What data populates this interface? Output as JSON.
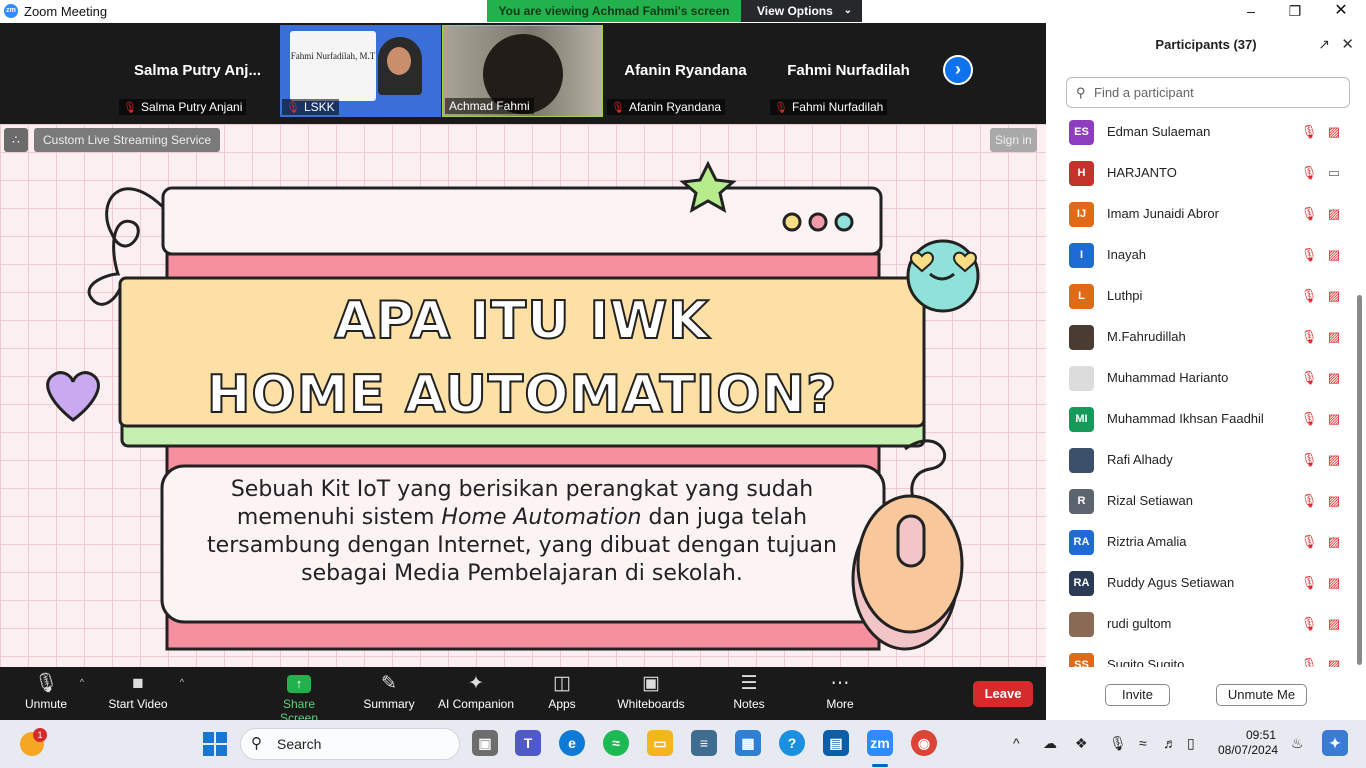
{
  "window": {
    "title": "Zoom Meeting",
    "app_icon": "zm"
  },
  "share_banner": {
    "text": "You are viewing Achmad Fahmi's screen",
    "view_options": "View Options"
  },
  "filmstrip": [
    {
      "big_name": "Salma  Putry  Anj...",
      "label": "Salma Putry Anjani",
      "muted": true
    },
    {
      "card_text": "Fahmi Nurfadilah, M.T",
      "label": "LSKK",
      "muted": true
    },
    {
      "label": "Achmad Fahmi",
      "muted": false
    },
    {
      "big_name": "Afanin Ryandana",
      "label": "Afanin Ryandana",
      "muted": true
    },
    {
      "big_name": "Fahmi Nurfadilah",
      "label": "Fahmi Nurfadilah",
      "muted": true
    }
  ],
  "stage": {
    "stream_label": "Custom Live Streaming Service",
    "sign_in": "Sign in",
    "slide_title_line1": "APA ITU IWK",
    "slide_title_line2": "HOME AUTOMATION?",
    "slide_body_1": "Sebuah  Kit  IoT  yang berisikan  perangkat  yang sudah  memenuhi  sistem ",
    "slide_body_italic": "Home  Automation",
    "slide_body_2": "  dan juga telah  tersambung  dengan  Internet,  yang  dibuat dengan  tujuan  sebagai  Media Pembelajaran di sekolah."
  },
  "toolbar": {
    "unmute": "Unmute",
    "start_video": "Start Video",
    "share_screen": "Share Screen",
    "summary": "Summary",
    "ai_companion": "AI Companion",
    "apps": "Apps",
    "whiteboards": "Whiteboards",
    "notes": "Notes",
    "more": "More",
    "leave": "Leave"
  },
  "participants": {
    "title": "Participants (37)",
    "search_placeholder": "Find a participant",
    "invite": "Invite",
    "unmute_me": "Unmute Me",
    "items": [
      {
        "initials": "ES",
        "name": "Edman Sulaeman",
        "color": "#8e3dbf",
        "video_on": false
      },
      {
        "initials": "H",
        "name": "HARJANTO",
        "color": "#c2332b",
        "video_on": true
      },
      {
        "initials": "IJ",
        "name": "Imam Junaidi Abror",
        "color": "#e06a17",
        "video_on": false
      },
      {
        "initials": "I",
        "name": "Inayah",
        "color": "#1f6bd6",
        "video_on": false
      },
      {
        "initials": "L",
        "name": "Luthpi",
        "color": "#e06a17",
        "video_on": false
      },
      {
        "initials": "",
        "name": "M.Fahrudillah",
        "color": "#4a3b33",
        "video_on": false
      },
      {
        "initials": "",
        "name": "Muhammad Harianto",
        "color": "#dcdcdc",
        "video_on": false
      },
      {
        "initials": "MI",
        "name": "Muhammad Ikhsan Faadhil",
        "color": "#159a5a",
        "video_on": false
      },
      {
        "initials": "",
        "name": "Rafi Alhady",
        "color": "#3c4f6b",
        "video_on": false
      },
      {
        "initials": "R",
        "name": "Rizal Setiawan",
        "color": "#5c6470",
        "video_on": false
      },
      {
        "initials": "RA",
        "name": "Riztria Amalia",
        "color": "#1f6bd6",
        "video_on": false
      },
      {
        "initials": "RA",
        "name": "Ruddy Agus Setiawan",
        "color": "#2c3b55",
        "video_on": false
      },
      {
        "initials": "",
        "name": "rudi gultom",
        "color": "#8a6a55",
        "video_on": false
      },
      {
        "initials": "SS",
        "name": "Sugito Sugito",
        "color": "#e06a17",
        "video_on": false
      }
    ]
  },
  "taskbar": {
    "search": "Search",
    "time": "09:51",
    "date": "08/07/2024",
    "notification_count": "1"
  }
}
